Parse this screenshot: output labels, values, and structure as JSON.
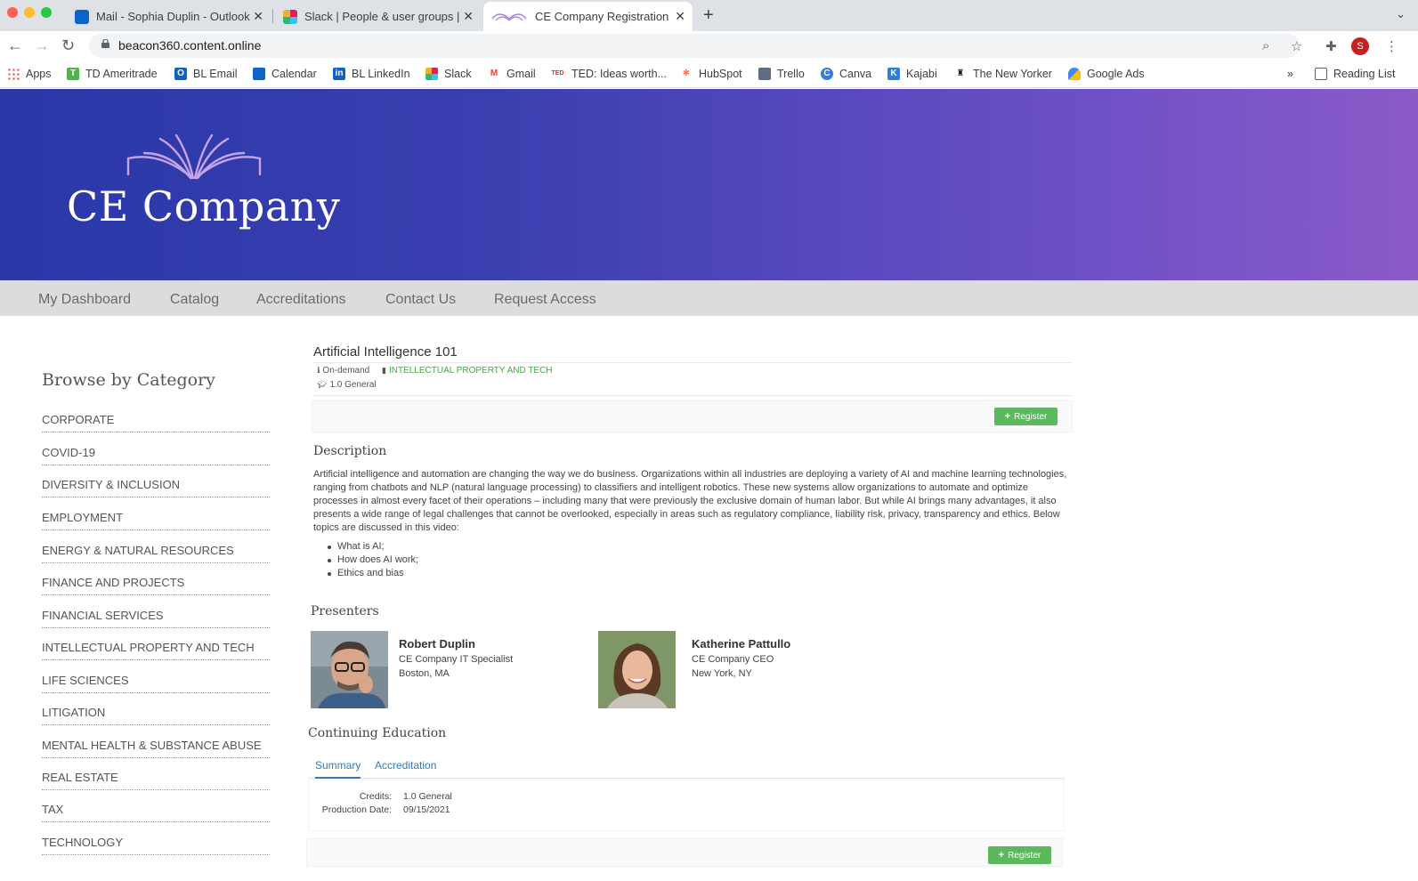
{
  "browser": {
    "tabs": [
      {
        "title": "Mail - Sophia Duplin - Outlook",
        "close": "✕"
      },
      {
        "title": "Slack | People & user groups |",
        "close": "✕"
      },
      {
        "title": "CE Company Registration",
        "close": "✕"
      }
    ],
    "new_tab": "+",
    "url": "beacon360.content.online",
    "profile_initial": "S",
    "bookmarks": [
      "Apps",
      "TD Ameritrade",
      "BL Email",
      "Calendar",
      "BL LinkedIn",
      "Slack",
      "Gmail",
      "TED: Ideas worth...",
      "HubSpot",
      "Trello",
      "Canva",
      "Kajabi",
      "The New Yorker",
      "Google Ads"
    ],
    "bookmark_overflow": "»",
    "reading_list": "Reading List"
  },
  "site": {
    "brand": "CE Company",
    "nav": [
      "My Dashboard",
      "Catalog",
      "Accreditations",
      "Contact Us",
      "Request Access"
    ],
    "sidebar": {
      "title": "Browse by Category",
      "categories": [
        "CORPORATE",
        "COVID-19",
        "DIVERSITY & INCLUSION",
        "EMPLOYMENT",
        "ENERGY & NATURAL RESOURCES",
        "FINANCE AND PROJECTS",
        "FINANCIAL SERVICES",
        "INTELLECTUAL PROPERTY AND TECH",
        "LIFE SCIENCES",
        "LITIGATION",
        "MENTAL HEALTH & SUBSTANCE ABUSE",
        "REAL ESTATE",
        "TAX",
        "TECHNOLOGY"
      ]
    },
    "course": {
      "title": "Artificial Intelligence 101",
      "format": "On-demand",
      "category": "INTELLECTUAL PROPERTY AND TECH",
      "credits_short": "1.0 General",
      "register_label": "Register",
      "description_heading": "Description",
      "description": "Artificial intelligence and automation are changing the way we do business. Organizations within all industries are deploying a variety of AI and machine learning technologies, ranging from chatbots and NLP (natural language processing) to classifiers and intelligent robotics. These new systems allow organizations to automate and optimize processes in almost every facet of their operations – including many that were previously the exclusive domain of human labor. But while AI brings many advantages, it also presents a wide range of legal challenges that cannot be overlooked, especially in areas such as regulatory compliance, liability risk, privacy, transparency and ethics. Below topics are discussed in this video:",
      "topics": [
        "What is AI;",
        "How does AI work;",
        "Ethics and bias"
      ],
      "presenters_heading": "Presenters",
      "presenters": [
        {
          "name": "Robert Duplin",
          "role": "CE Company IT Specialist",
          "location": "Boston, MA"
        },
        {
          "name": "Katherine Pattullo",
          "role": "CE Company CEO",
          "location": "New York, NY"
        }
      ],
      "ce_heading": "Continuing Education",
      "ce_tabs": [
        "Summary",
        "Accreditation"
      ],
      "ce_summary": {
        "credits_label": "Credits:",
        "credits_value": "1.0 General",
        "date_label": "Production Date:",
        "date_value": "09/15/2021"
      }
    }
  }
}
